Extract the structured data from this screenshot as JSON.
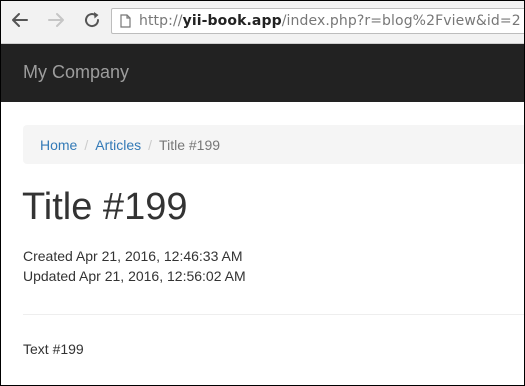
{
  "browser": {
    "url_scheme": "http://",
    "url_host": "yii-book.app",
    "url_path": "/index.php?r=blog%2Fview&id=2"
  },
  "navbar": {
    "brand": "My Company"
  },
  "breadcrumb": {
    "items": [
      "Home",
      "Articles"
    ],
    "separator": "/",
    "active": "Title #199"
  },
  "article": {
    "title": "Title #199",
    "created": "Created Apr 21, 2016, 12:46:33 AM",
    "updated": "Updated Apr 21, 2016, 12:56:02 AM",
    "body": "Text #199"
  },
  "colors": {
    "navbar_bg": "#222222",
    "brand": "#9d9d9d",
    "link": "#337ab7",
    "breadcrumb_bg": "#f5f5f5"
  },
  "icons": [
    "back-arrow-icon",
    "forward-arrow-icon",
    "reload-icon",
    "page-icon"
  ]
}
